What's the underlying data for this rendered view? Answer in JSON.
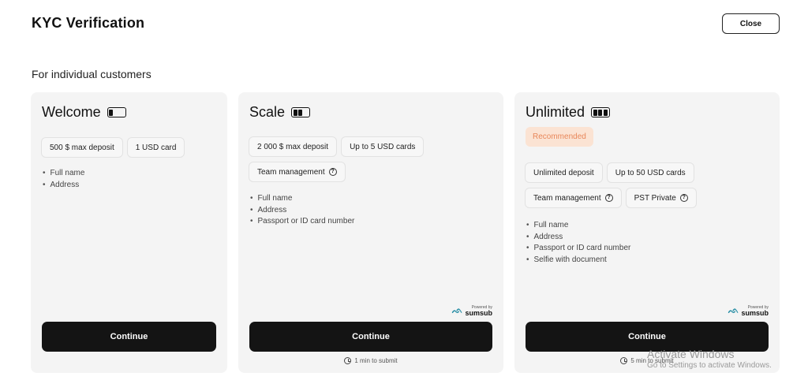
{
  "header": {
    "title": "KYC Verification",
    "close_label": "Close"
  },
  "section": {
    "title": "For individual customers"
  },
  "cards": [
    {
      "title": "Welcome",
      "tier_icon": "battery-1-bar-icon",
      "limits": [
        "500 $ max deposit",
        "1 USD card"
      ],
      "requirements": [
        "Full name",
        "Address"
      ],
      "continue_label": "Continue"
    },
    {
      "title": "Scale",
      "tier_icon": "battery-2-bar-icon",
      "limits": [
        "2 000 $ max deposit",
        "Up to 5 USD cards"
      ],
      "features": [
        "Team management"
      ],
      "requirements": [
        "Full name",
        "Address",
        "Passport or ID card number"
      ],
      "powered_by": "Powered by",
      "provider": "sumsub",
      "continue_label": "Continue",
      "time_note": "1 min to submit"
    },
    {
      "title": "Unlimited",
      "tier_icon": "battery-3-bar-icon",
      "badge": "Recommended",
      "limits": [
        "Unlimited deposit",
        "Up to 50 USD cards"
      ],
      "features": [
        "Team management",
        "PST Private"
      ],
      "requirements": [
        "Full name",
        "Address",
        "Passport or ID card number",
        "Selfie with document"
      ],
      "powered_by": "Powered by",
      "provider": "sumsub",
      "continue_label": "Continue",
      "time_note": "5 min to submit"
    }
  ],
  "watermark": {
    "line1": "Activate Windows",
    "line2": "Go to Settings to activate Windows."
  },
  "colors": {
    "card_bg": "#f4f4f4",
    "button_bg": "#141414",
    "badge_bg": "#fbe3d3",
    "badge_text": "#e8875a",
    "brand_teal": "#2a8fa6"
  }
}
